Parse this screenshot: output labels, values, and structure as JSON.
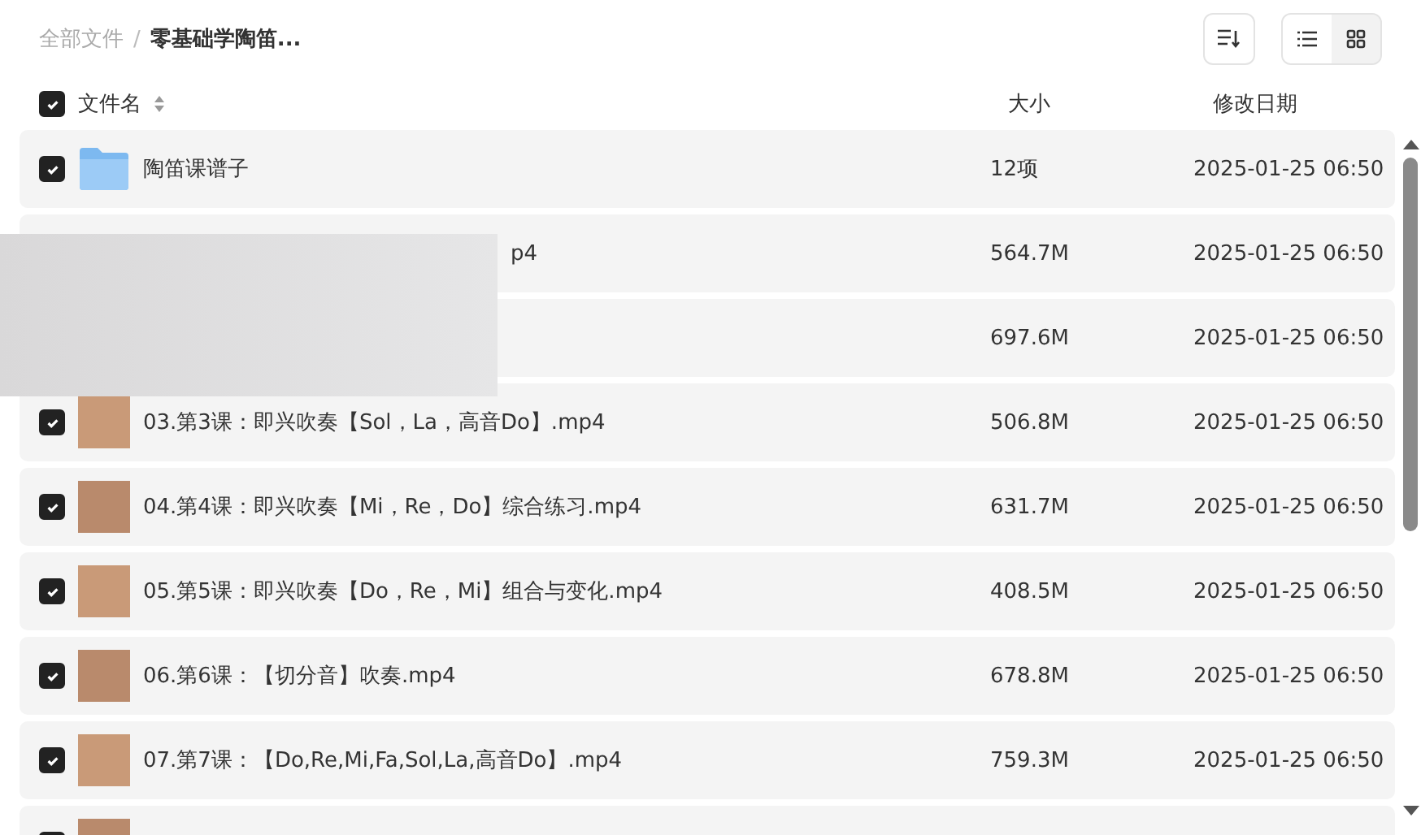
{
  "breadcrumb": [
    {
      "label": "全部文件",
      "current": false
    },
    {
      "label": "零基础学陶笛...",
      "current": true
    }
  ],
  "breadcrumb_separator": "/",
  "view_toggle": [
    {
      "kind": "list",
      "selected": true
    },
    {
      "kind": "grid",
      "selected": false
    }
  ],
  "header": {
    "checked": true,
    "columns": [
      "文件名",
      "大小",
      "修改日期"
    ]
  },
  "rows": [
    {
      "kind": "folder",
      "checked": true,
      "name": "陶笛课谱子",
      "size": "12项",
      "date": "2025-01-25 06:50"
    },
    {
      "kind": "obscured",
      "name": "p4",
      "size": "564.7M",
      "date": "2025-01-25 06:50"
    },
    {
      "kind": "hidden",
      "size": "697.6M",
      "date": "2025-01-25 06:50"
    },
    {
      "kind": "video",
      "checked": true,
      "name": "03.第3课：即兴吹奏【Sol，La，高音Do】.mp4",
      "size": "506.8M",
      "date": "2025-01-25 06:50"
    },
    {
      "kind": "video",
      "checked": true,
      "name": "04.第4课：即兴吹奏【Mi，Re，Do】综合练习.mp4",
      "size": "631.7M",
      "date": "2025-01-25 06:50"
    },
    {
      "kind": "video",
      "checked": true,
      "name": "05.第5课：即兴吹奏【Do，Re，Mi】组合与变化.mp4",
      "size": "408.5M",
      "date": "2025-01-25 06:50"
    },
    {
      "kind": "video",
      "checked": true,
      "name": "06.第6课：【切分音】吹奏.mp4",
      "size": "678.8M",
      "date": "2025-01-25 06:50"
    },
    {
      "kind": "video",
      "checked": true,
      "name": "07.第7课：【Do,Re,Mi,Fa,Sol,La,高音Do】.mp4",
      "size": "759.3M",
      "date": "2025-01-25 06:50"
    },
    {
      "kind": "cut",
      "checked": true
    }
  ]
}
